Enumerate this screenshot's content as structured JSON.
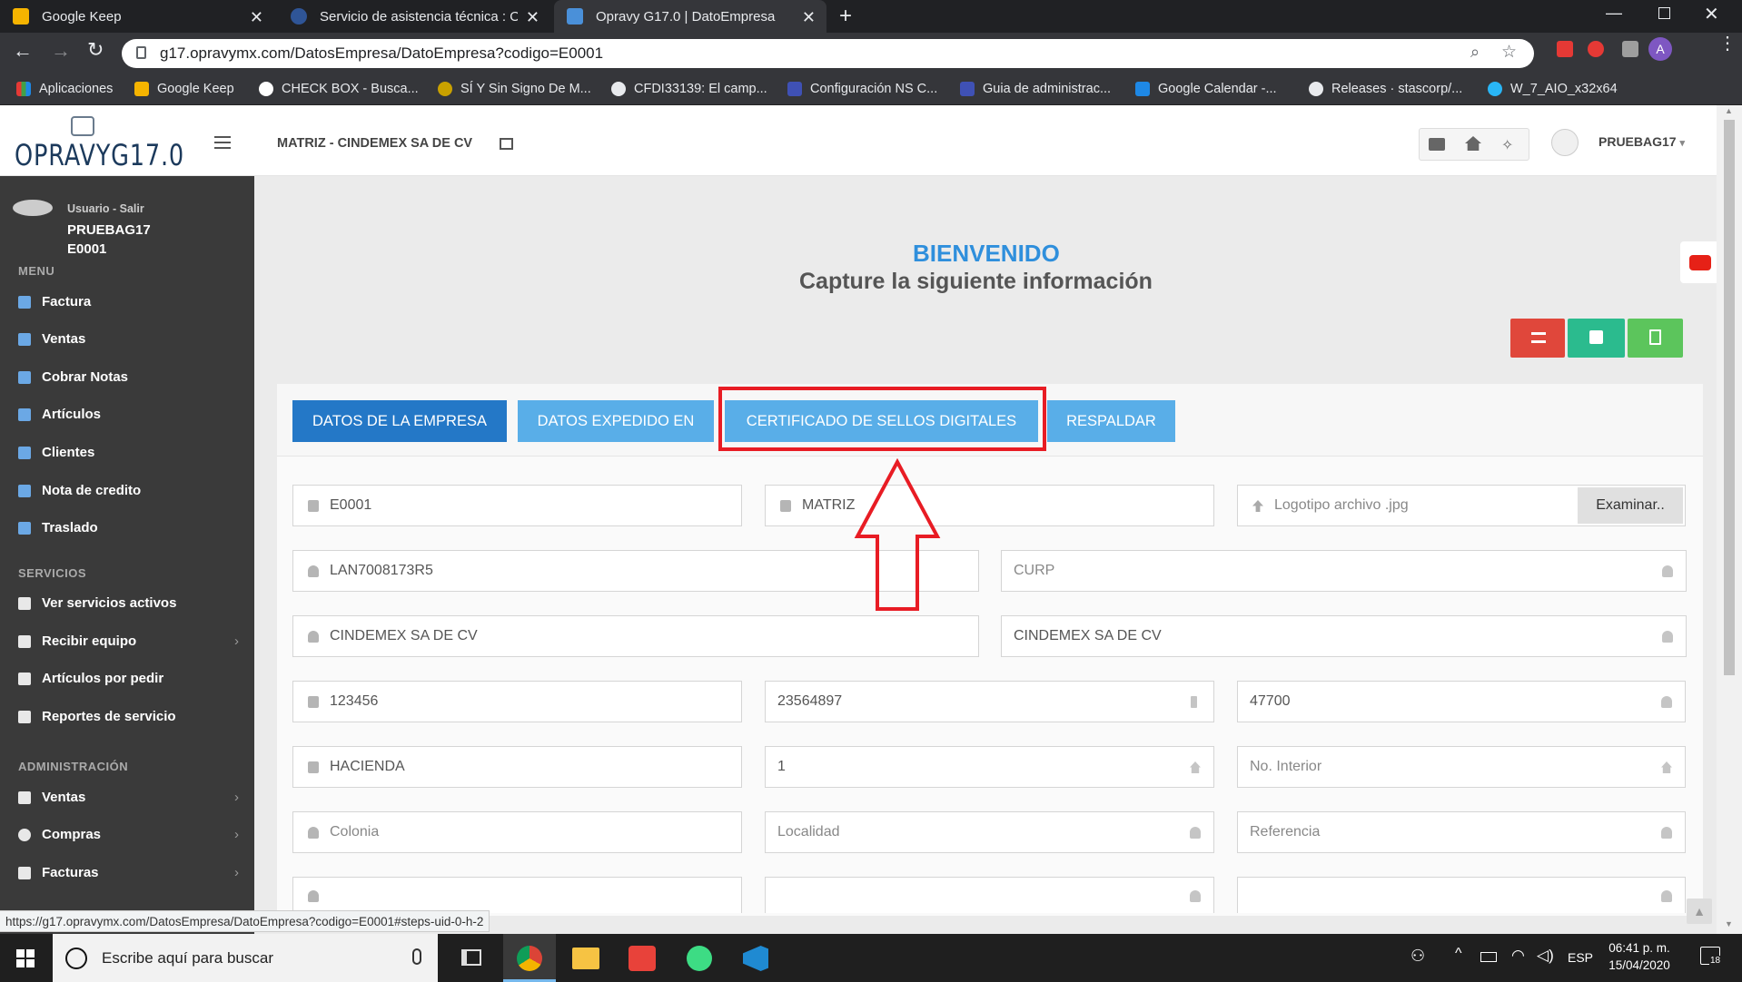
{
  "browser": {
    "tabs": [
      {
        "title": "Google Keep",
        "favicon": "keep-icon",
        "color": "#f6b400"
      },
      {
        "title": "Servicio de asistencia técnica : Op",
        "favicon": "support-icon",
        "color": "#3a7bd5"
      },
      {
        "title": "Opravy G17.0 | DatoEmpresa",
        "favicon": "opravy-icon",
        "color": "#4a90d9"
      }
    ],
    "url": "g17.opravymx.com/DatosEmpresa/DatoEmpresa?codigo=E0001",
    "profile_initial": "A",
    "bookmarks": [
      "Aplicaciones",
      "Google Keep",
      "CHECK BOX - Busca...",
      "SÍ Y Sin Signo De M...",
      "CFDI33139: El camp...",
      "Configuración NS C...",
      "Guia de administrac...",
      "Google Calendar -...",
      "Releases · stascorp/...",
      "W_7_AIO_x32x64"
    ]
  },
  "app": {
    "logo": "OPRAVYG17.0",
    "company": "MATRIZ - CINDEMEX SA DE CV",
    "user_menu": "PRUEBAG17",
    "sidebar": {
      "user_caption": "Usuario - Salir",
      "user_name": "PRUEBAG17",
      "user_code": "E0001",
      "sections": {
        "menu": "MENU",
        "servicios": "SERVICIOS",
        "admin": "ADMINISTRACIÓN"
      },
      "menu_items": [
        "Factura",
        "Ventas",
        "Cobrar Notas",
        "Artículos",
        "Clientes",
        "Nota de credito",
        "Traslado"
      ],
      "servicios_items": [
        "Ver servicios activos",
        "Recibir equipo",
        "Artículos por pedir",
        "Reportes de servicio"
      ],
      "admin_items": [
        "Ventas",
        "Compras",
        "Facturas"
      ]
    },
    "welcome_title": "BIENVENIDO",
    "welcome_subtitle": "Capture la siguiente información",
    "steps": [
      "DATOS DE LA EMPRESA",
      "DATOS EXPEDIDO EN",
      "CERTIFICADO DE SELLOS DIGITALES",
      "RESPALDAR"
    ],
    "fields": {
      "codigo": "E0001",
      "sucursal": "MATRIZ",
      "logo_placeholder": "Logotipo archivo .jpg",
      "browse": "Examinar..",
      "rfc": "LAN7008173R5",
      "curp": "CURP",
      "razon_social": "CINDEMEX SA DE CV",
      "nombre_comercial": "CINDEMEX SA DE CV",
      "telefono": "123456",
      "celular": "23564897",
      "cp": "47700",
      "calle": "HACIENDA",
      "num_ext": "1",
      "num_int": "No. Interior",
      "colonia": "Colonia",
      "localidad": "Localidad",
      "referencia": "Referencia"
    },
    "status_url": "https://g17.opravymx.com/DatosEmpresa/DatoEmpresa?codigo=E0001#steps-uid-0-h-2"
  },
  "taskbar": {
    "search_placeholder": "Escribe aquí para buscar",
    "lang": "ESP",
    "time": "06:41 p. m.",
    "date": "15/04/2020",
    "notif_count": "18"
  },
  "colors": {
    "accent_blue": "#59aee8",
    "active_tab": "#2478c7",
    "highlight_red": "#e81c24",
    "btn_red": "#e0473b",
    "btn_teal": "#2bbb8e",
    "btn_green": "#5cc55c"
  }
}
